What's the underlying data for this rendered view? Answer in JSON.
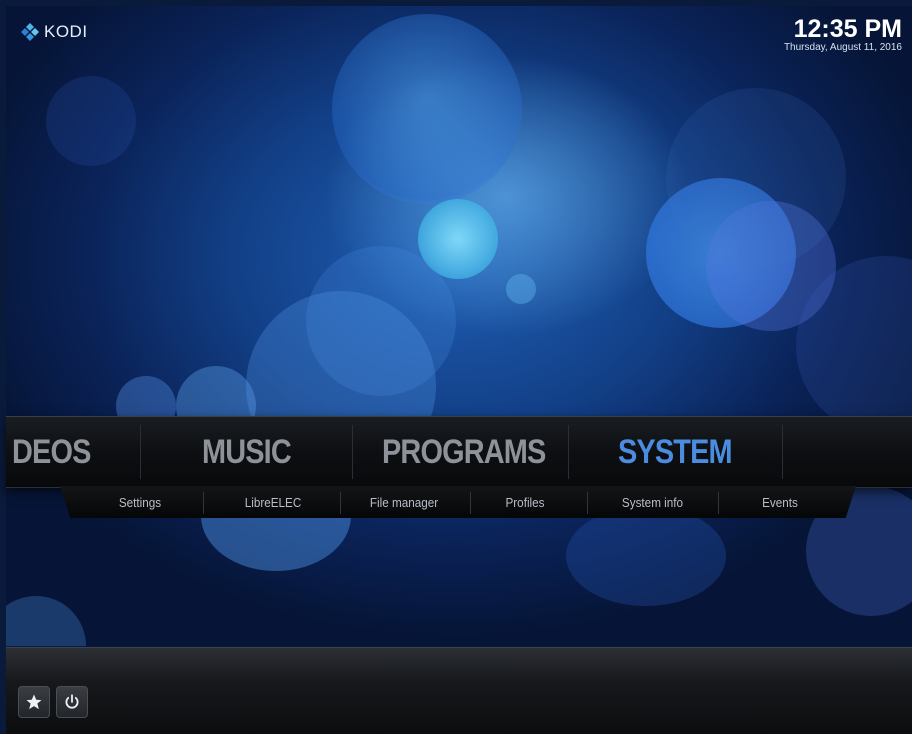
{
  "app": {
    "logo_text": "KODI"
  },
  "clock": {
    "time": "12:35 PM",
    "date": "Thursday, August 11, 2016"
  },
  "main_menu": {
    "items": [
      {
        "label": "DEOS",
        "active": false
      },
      {
        "label": "MUSIC",
        "active": false
      },
      {
        "label": "PROGRAMS",
        "active": false
      },
      {
        "label": "SYSTEM",
        "active": true
      }
    ]
  },
  "submenu": {
    "items": [
      {
        "label": "Settings"
      },
      {
        "label": "LibreELEC"
      },
      {
        "label": "File manager"
      },
      {
        "label": "Profiles"
      },
      {
        "label": "System info"
      },
      {
        "label": "Events"
      }
    ]
  },
  "bottom_bar": {
    "buttons": [
      {
        "icon": "star-icon"
      },
      {
        "icon": "power-icon"
      }
    ]
  },
  "colors": {
    "accent": "#4a8ce0",
    "inactive_menu": "#8e939a",
    "background": "#123f86"
  }
}
